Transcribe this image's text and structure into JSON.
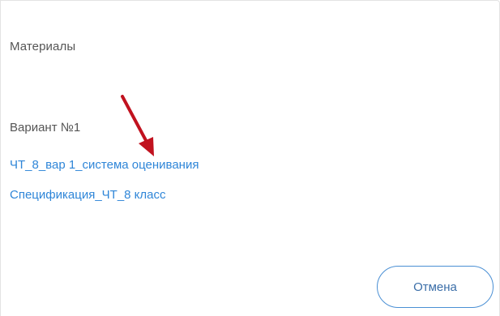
{
  "materials": {
    "heading": "Материалы",
    "variant_heading": "Вариант №1",
    "links": [
      {
        "label": "ЧТ_8_вар 1_система оценивания"
      },
      {
        "label": "Спецификация_ЧТ_8 класс"
      }
    ]
  },
  "actions": {
    "cancel_label": "Отмена"
  },
  "colors": {
    "link": "#2f86d8",
    "arrow": "#c1121f",
    "button_border": "#4a8fd4"
  },
  "icons": {
    "annotation": "red-arrow-icon"
  }
}
